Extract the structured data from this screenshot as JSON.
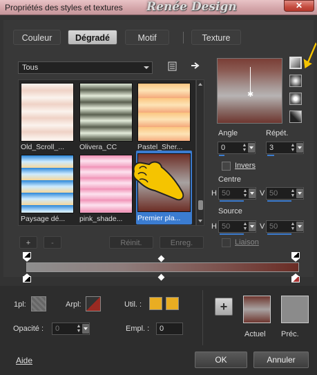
{
  "window": {
    "title": "Propriétés des styles et textures",
    "brand": "Renée Design",
    "close_glyph": "✕"
  },
  "tabs": [
    {
      "label": "Couleur",
      "active": false
    },
    {
      "label": "Dégradé",
      "active": true
    },
    {
      "label": "Motif",
      "active": false
    },
    {
      "label": "Texture",
      "active": false
    }
  ],
  "gradient_list": {
    "category": "Tous",
    "icons": [
      "list-icon",
      "arrow-right-icon"
    ],
    "items": [
      {
        "label": "Old_Scroll_...",
        "selected": false,
        "colors": [
          "#fbf4ef",
          "#efd2c6",
          "#fbf2ec"
        ]
      },
      {
        "label": "Olivera_CC",
        "selected": false,
        "colors": [
          "#dfe8d6",
          "#5b6050",
          "#e8efde"
        ]
      },
      {
        "label": "Pastel_Sher...",
        "selected": false,
        "colors": [
          "#fbc680",
          "#fde3b6",
          "#f4a87a"
        ]
      },
      {
        "label": "Paysage dé...",
        "selected": false,
        "colors": [
          "#2b86d8",
          "#cdebff",
          "#f6d79a"
        ]
      },
      {
        "label": "pink_shade...",
        "selected": false,
        "colors": [
          "#f08fb4",
          "#fde2ef",
          "#f3a4c3"
        ]
      },
      {
        "label": "Premier pla...",
        "selected": true,
        "colors": [
          "#6d2f27",
          "#a7a2a1",
          "#6d2f27"
        ]
      }
    ],
    "buttons": {
      "add": "+",
      "remove": "-",
      "reset": "Réinit.",
      "save": "Enreg."
    }
  },
  "settings": {
    "angle_label": "Angle",
    "angle_value": "0",
    "repeat_label": "Répét.",
    "repeat_value": "3",
    "invert_label": "Invers",
    "center_label": "Centre",
    "center_h": "50",
    "center_v": "50",
    "source_label": "Source",
    "source_h": "50",
    "source_v": "50",
    "link_label": "Liaison",
    "h_label": "H",
    "v_label": "V",
    "styles": [
      "linear-style-icon",
      "rectangular-style-icon",
      "sunburst-style-icon",
      "radial-style-icon"
    ]
  },
  "gradient_bar": {
    "start_color": "#8e8e8e",
    "end_color": "#6a2c25"
  },
  "bottom": {
    "first_plane_label": "1pl:",
    "back_plane_label": "Arpl:",
    "use_label": "Util. :",
    "opacity_label": "Opacité :",
    "opacity_value": "0",
    "position_label": "Empl. :",
    "position_value": "0",
    "use_color": "#e9ad22",
    "current_label": "Actuel",
    "previous_label": "Préc.",
    "add_glyph": "+"
  },
  "footer": {
    "help": "Aide",
    "ok": "OK",
    "cancel": "Annuler"
  },
  "colors": {
    "accent": "#3b7cd0",
    "title_bg": "#d3a4a8",
    "close_red": "#c44b3f",
    "hand_yellow": "#f5c400"
  }
}
